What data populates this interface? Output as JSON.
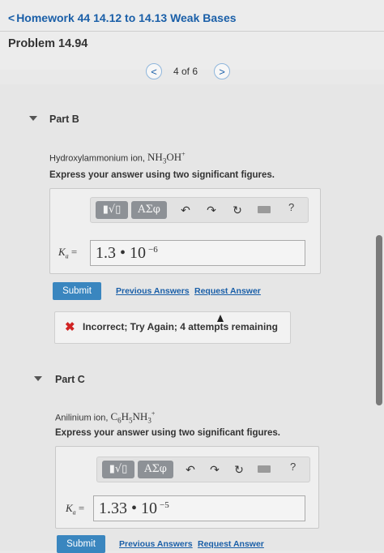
{
  "header": {
    "back_chevron": "<",
    "back_label": "Homework 44 14.12 to 14.13 Weak Bases",
    "problem_title": "Problem 14.94"
  },
  "pager": {
    "prev": "<",
    "count": "4 of 6",
    "next": ">"
  },
  "parts": [
    {
      "label": "Part B",
      "prompt_text": "Hydroxylammonium ion, ",
      "prompt_formula": "NH3OH+",
      "instruction": "Express your answer using two significant figures.",
      "toolbar": {
        "templates": "▮√▯",
        "greek": "ΑΣφ",
        "help": "?"
      },
      "k_label": "K",
      "k_sub": "a",
      "k_eq": " =",
      "answer_mantissa": "1.3 • 10",
      "answer_exponent": "−6",
      "submit": "Submit",
      "previous_answers": "Previous Answers",
      "request_answer": "Request Answer",
      "feedback": "Incorrect; Try Again; 4 attempts remaining"
    },
    {
      "label": "Part C",
      "prompt_text": "Anilinium ion, ",
      "prompt_formula": "C6H5NH3+",
      "instruction": "Express your answer using two significant figures.",
      "toolbar": {
        "templates": "▮√▯",
        "greek": "ΑΣφ",
        "help": "?"
      },
      "k_label": "K",
      "k_sub": "a",
      "k_eq": " =",
      "answer_mantissa": "1.33 • 10",
      "answer_exponent": "−5",
      "submit": "Submit",
      "previous_answers": "Previous Answers",
      "request_answer": "Request Answer"
    }
  ],
  "colors": {
    "link": "#1a5fa8",
    "submit": "#3a86bf",
    "error": "#d02323"
  }
}
